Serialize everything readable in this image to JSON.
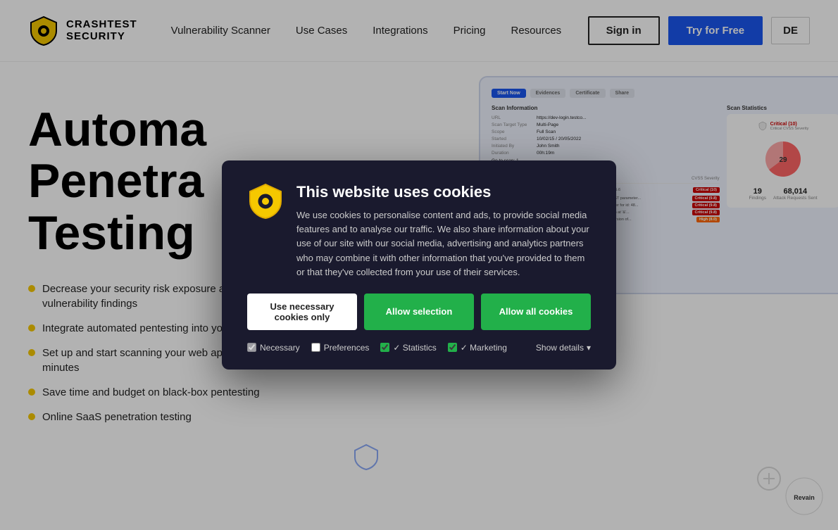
{
  "navbar": {
    "logo_line1": "CRASHTEST",
    "logo_line2": "SECURITY",
    "links": [
      {
        "label": "Vulnerability Scanner",
        "id": "vulnerability-scanner"
      },
      {
        "label": "Use Cases",
        "id": "use-cases"
      },
      {
        "label": "Integrations",
        "id": "integrations"
      },
      {
        "label": "Pricing",
        "id": "pricing"
      },
      {
        "label": "Resources",
        "id": "resources"
      }
    ],
    "signin_label": "Sign in",
    "try_label": "Try for Free",
    "lang_label": "DE"
  },
  "hero": {
    "title_line1": "Automa",
    "title_line2": "Penetra",
    "title_line3": "Testing",
    "title_full": "Automated\nPenetration\nTesting",
    "bullets": [
      "Decrease your security risk exposure and mitigate critical and important vulnerability findings",
      "Integrate automated pentesting into your current dev stack",
      "Set up and start scanning your web applications, JavaScript, or API in minutes",
      "Save time and budget on black-box pentesting",
      "Online SaaS penetration testing"
    ]
  },
  "cookie": {
    "title": "This website uses cookies",
    "description": "We use cookies to personalise content and ads, to provide social media features and to analyse our traffic. We also share information about your use of our site with our social media, advertising and analytics partners who may combine it with other information that you've provided to them or that they've collected from your use of their services.",
    "btn_necessary": "Use necessary cookies only",
    "btn_selection": "Allow selection",
    "btn_all": "Allow all cookies",
    "options": [
      {
        "label": "Necessary",
        "checked": true,
        "disabled": true
      },
      {
        "label": "Preferences",
        "checked": false,
        "disabled": false
      },
      {
        "label": "Statistics",
        "checked": true,
        "disabled": false
      },
      {
        "label": "Marketing",
        "checked": true,
        "disabled": false
      }
    ],
    "show_details": "Show details"
  },
  "colors": {
    "accent_blue": "#1a56f0",
    "accent_green": "#22b04a",
    "accent_yellow": "#f5c800",
    "modal_bg": "#1a1a2e",
    "critical_red": "#cc0000"
  }
}
